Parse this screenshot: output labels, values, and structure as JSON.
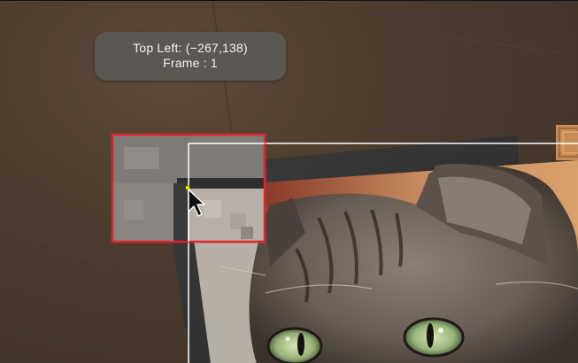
{
  "hud": {
    "position_label": "Top Left:",
    "coords_text": "(−267,138)",
    "frame_label": "Frame : 1"
  },
  "colors": {
    "background": "#4a3b2e",
    "selection_outline": "#ffffff",
    "zoom_loupe_border": "#e3222a",
    "corner_handle": "#f2e600",
    "hud_background": "#5c5a56"
  },
  "icons": {
    "cursor": "arrow-pointer-icon",
    "handle": "corner-handle-icon"
  }
}
